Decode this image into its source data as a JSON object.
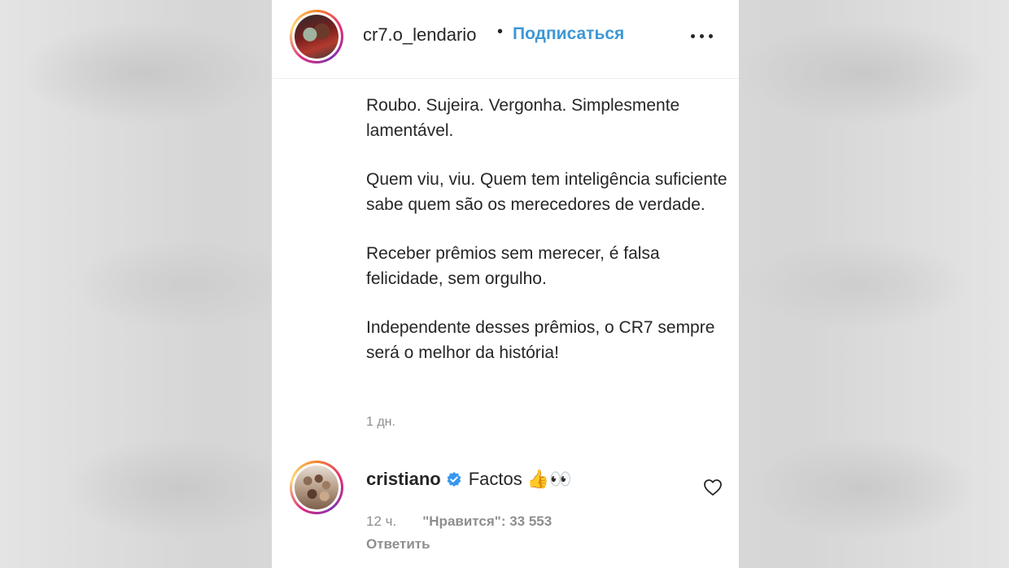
{
  "post": {
    "author": {
      "username": "cr7.o_lendario",
      "separator": "•",
      "follow_label": "Подписаться"
    },
    "caption": {
      "paragraphs": [
        "Roubo. Sujeira. Vergonha. Simplesmente lamentável.",
        "Quem viu, viu. Quem tem inteligência suficiente sabe quem são os merecedores de verdade.",
        "Receber prêmios sem merecer, é falsa felicidade, sem orgulho.",
        "Independente desses prêmios, o CR7 sempre será o melhor da história!"
      ]
    },
    "posted_time": "1 дн."
  },
  "comment": {
    "username": "cristiano",
    "text": "Factos",
    "emoji": "👍👀",
    "time": "12 ч.",
    "likes": "\"Нравится\": 33 553",
    "reply_label": "Ответить"
  },
  "colors": {
    "link_blue": "#3e98d4",
    "verified_blue": "#3897f0",
    "text_primary": "#262626",
    "text_secondary": "#8e8e8e"
  },
  "icons": {
    "more": "more-options-icon",
    "verified": "verified-badge-icon",
    "like": "heart-outline-icon"
  }
}
